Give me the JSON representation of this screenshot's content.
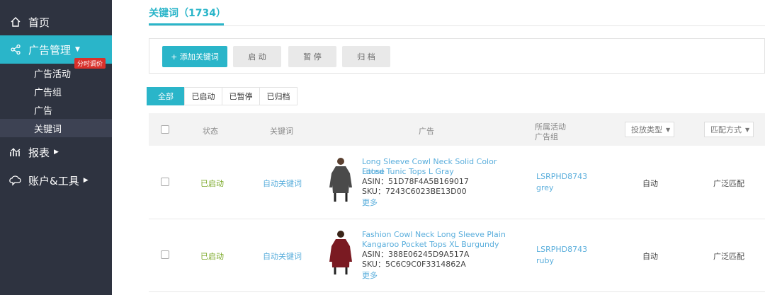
{
  "sidebar": {
    "home": "首页",
    "ad_management": "广告管理",
    "ad_management_arrow": "▼",
    "badge": "分时调价",
    "sub_items": [
      "广告活动",
      "广告组",
      "广告",
      "关键词"
    ],
    "reports": "报表",
    "reports_arrow": "▶",
    "account_tools": "账户&工具",
    "account_tools_arrow": "▶"
  },
  "main": {
    "title": "关键词（1734）",
    "toolbar": {
      "add_keyword": "+ 添加关键词",
      "start": "启 动",
      "pause": "暂 停",
      "archive": "归 档"
    },
    "tabs": [
      "全部",
      "已启动",
      "已暂停",
      "已归档"
    ],
    "table": {
      "headers": {
        "status": "状态",
        "keyword": "关键词",
        "ad": "广告",
        "campaign": "所属活动",
        "adgroup": "广告组",
        "delivery_type": "投放类型",
        "match_type": "匹配方式"
      },
      "rows": [
        {
          "status": "已启动",
          "keyword": "自动关键词",
          "ad_title_1": "Long Sleeve Cowl Neck Solid Color Loose",
          "ad_title_2": "Fitted Tunic Tops L Gray",
          "asin": "ASIN：51D78F4A5B169017",
          "sku": "SKU：7243C6023BE13D00",
          "more": "更多",
          "group_1": "LSRPHD8743",
          "group_2": "grey",
          "delivery": "自动",
          "match": "广泛匹配"
        },
        {
          "status": "已启动",
          "keyword": "自动关键词",
          "ad_title_1": "Fashion Cowl Neck Long Sleeve Plain",
          "ad_title_2": "Kangaroo Pocket Tops XL Burgundy",
          "asin": "ASIN：388E06245D9A517A",
          "sku": "SKU：5C6C9C0F3314862A",
          "more": "更多",
          "group_1": "LSRPHD8743",
          "group_2": "ruby",
          "delivery": "自动",
          "match": "广泛匹配"
        }
      ]
    }
  },
  "colors": {
    "accent": "#2ab5c9",
    "sidebar_bg": "#2e3340",
    "badge": "#d9312b",
    "status_green": "#7aa827",
    "link_blue": "#5aaedc"
  },
  "icons": [
    "home-icon",
    "share-nodes-icon",
    "bar-chart-icon",
    "chat-cloud-icon",
    "dropdown-caret-icon"
  ]
}
